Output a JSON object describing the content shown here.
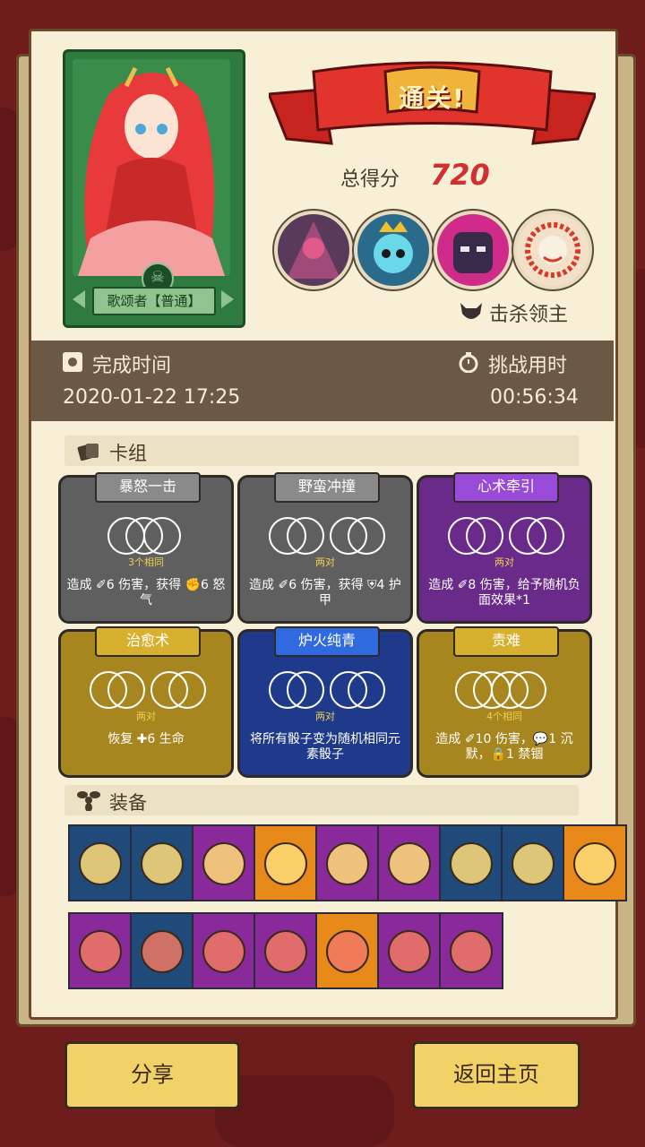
{
  "hero": {
    "name": "歌颂者【普通】"
  },
  "result": {
    "title": "通关!",
    "score_label": "总得分",
    "score": "720",
    "kill_label": "击杀领主"
  },
  "bosses": [
    "boss-1",
    "boss-2",
    "boss-3",
    "boss-4"
  ],
  "times": {
    "finish_label": "完成时间",
    "finish_value": "2020-01-22 17:25",
    "duration_label": "挑战用时",
    "duration_value": "00:56:34"
  },
  "deck": {
    "title": "卡组",
    "cards": [
      {
        "title": "暴怒一击",
        "req": "3个相同",
        "desc": "造成 ✐6 伤害，获得 ✊6 怒气",
        "color": "#5f5f5f"
      },
      {
        "title": "野蛮冲撞",
        "req": "两对",
        "desc": "造成 ✐6 伤害，获得 ⛨4 护甲",
        "color": "#5f5f5f"
      },
      {
        "title": "心术牵引",
        "req": "两对",
        "desc": "造成 ✐8 伤害，给予随机负面效果*1",
        "color": "#6a2a8a"
      },
      {
        "title": "治愈术",
        "req": "两对",
        "desc": "恢复 ✚6 生命",
        "color": "#a8861f"
      },
      {
        "title": "炉火纯青",
        "req": "两对",
        "desc": "将所有骰子变为随机相同元素骰子",
        "color": "#1f3a8a"
      },
      {
        "title": "责难",
        "req": "4个相同",
        "desc": "造成 ✐10 伤害，💬1 沉默，🔒1 禁锢",
        "color": "#a8861f"
      }
    ]
  },
  "equipment": {
    "title": "装备",
    "row1": [
      "#1f4a7a",
      "#1f4a7a",
      "#8a2a9a",
      "#e88a1a",
      "#8a2a9a",
      "#8a2a9a",
      "#1f4a7a",
      "#1f4a7a",
      "#e88a1a"
    ],
    "row2": [
      "#8a2a9a",
      "#1f4a7a",
      "#8a2a9a",
      "#8a2a9a",
      "#e88a1a",
      "#8a2a9a",
      "#8a2a9a"
    ]
  },
  "buttons": {
    "share": "分享",
    "home": "返回主页"
  }
}
